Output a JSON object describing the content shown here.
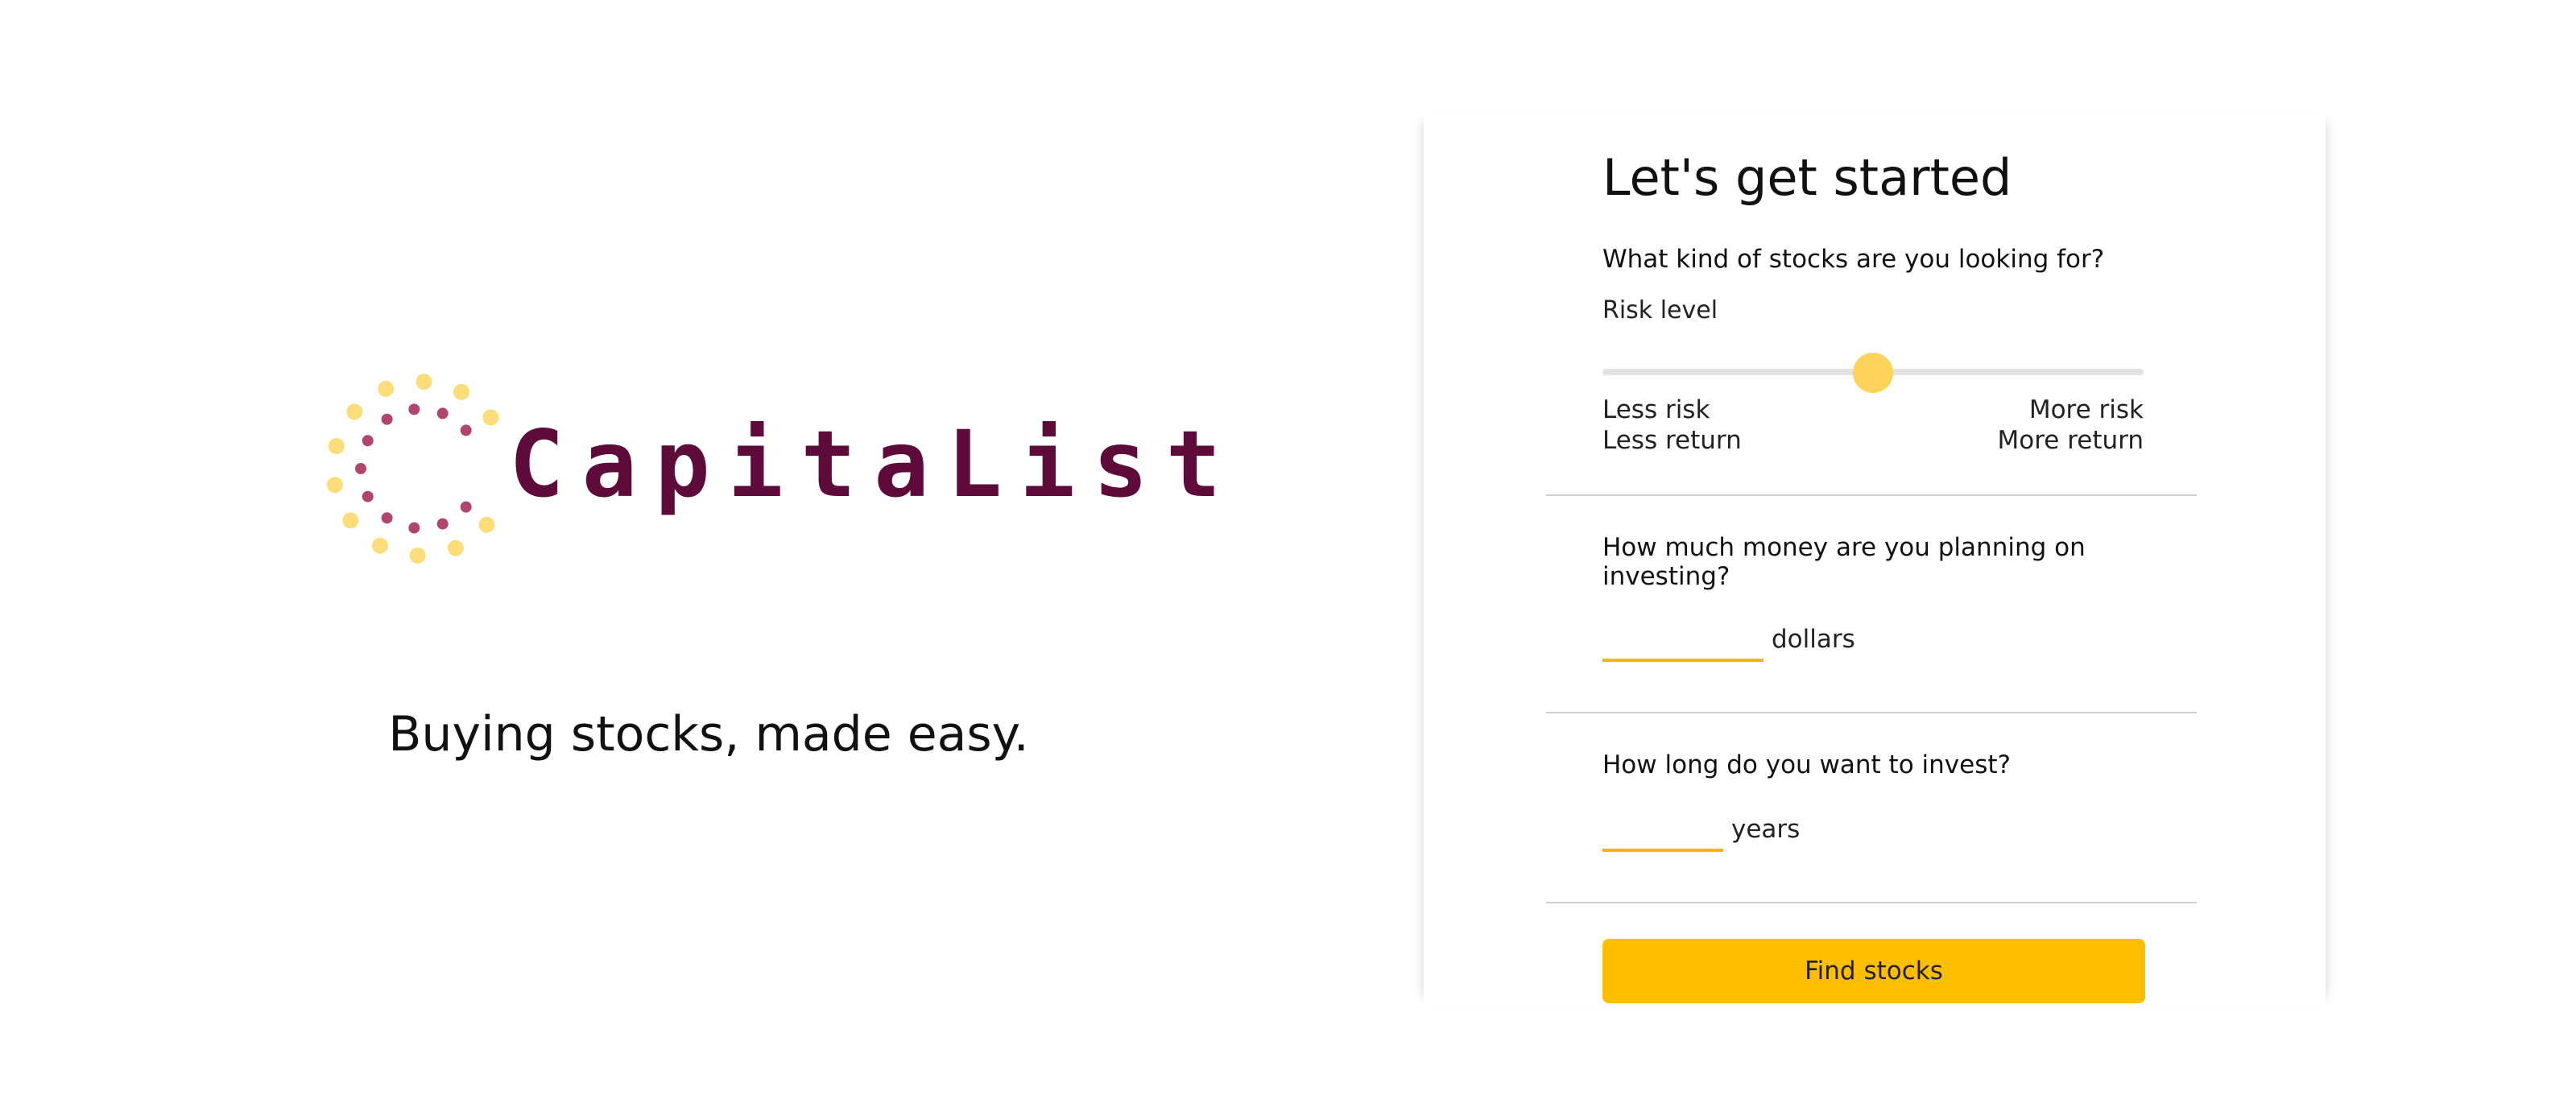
{
  "brand": {
    "logo_text": "CapitaList",
    "tagline": "Buying stocks, made easy."
  },
  "form": {
    "title": "Let's get started",
    "risk_question": "What kind of stocks are you looking for?",
    "risk_label": "Risk level",
    "risk_value": 0.5,
    "risk_min": {
      "line1": "Less risk",
      "line2": "Less return"
    },
    "risk_max": {
      "line1": "More risk",
      "line2": "More return"
    },
    "money_question": "How much money are you planning on investing?",
    "money_value": "",
    "money_unit": "dollars",
    "duration_question": "How long do you want to invest?",
    "duration_value": "",
    "duration_unit": "years",
    "submit_label": "Find stocks"
  },
  "colors": {
    "brand_primary": "#5e0b3c",
    "logo_dot_outer": "#fddc7a",
    "logo_dot_inner": "#b0466e",
    "accent": "#ffbf00",
    "slider_thumb": "#fdd35a",
    "input_underline": "#f2b705"
  }
}
